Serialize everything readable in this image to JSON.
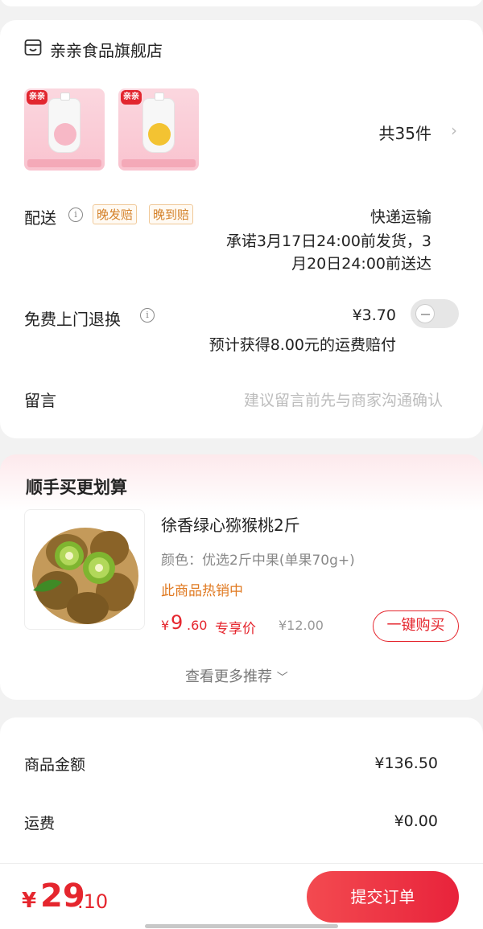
{
  "store": {
    "name": "亲亲食品旗舰店",
    "icon": "store-icon",
    "item_count": "共35件",
    "thumbnails": [
      {
        "brand": "亲亲",
        "fruit_color": "#f7b8c6"
      },
      {
        "brand": "亲亲",
        "fruit_color": "#f3c332"
      }
    ]
  },
  "delivery": {
    "label": "配送",
    "tags": [
      "晚发赔",
      "晚到赔"
    ],
    "method": "快递运输",
    "promise_line1": "承诺3月17日24:00前发货，3",
    "promise_line2": "月20日24:00前送达"
  },
  "return_service": {
    "label": "免费上门退换",
    "price": "¥3.70",
    "note": "预计获得8.00元的运费赔付",
    "enabled": false
  },
  "message": {
    "label": "留言",
    "placeholder": "建议留言前先与商家沟通确认"
  },
  "recommend": {
    "title": "顺手买更划算",
    "product": {
      "name": "徐香绿心猕猴桃2斤",
      "spec": "颜色：优选2斤中果(单果70g+)",
      "hot": "此商品热销中",
      "price_symbol": "¥",
      "price_int": "9",
      "price_dec": ".60",
      "exclusive": "专享价",
      "original_price": "¥12.00",
      "buy_label": "一键购买"
    },
    "more": "查看更多推荐"
  },
  "summary": {
    "rows": [
      {
        "label": "商品金额",
        "value": "¥136.50"
      },
      {
        "label": "运费",
        "value": "¥0.00"
      }
    ]
  },
  "bottom": {
    "symbol": "¥",
    "total_int": "29",
    "total_dec": ".10",
    "submit": "提交订单"
  },
  "colors": {
    "accent": "#e5262e",
    "tag": "#d4812a",
    "hot": "#e07a22"
  }
}
